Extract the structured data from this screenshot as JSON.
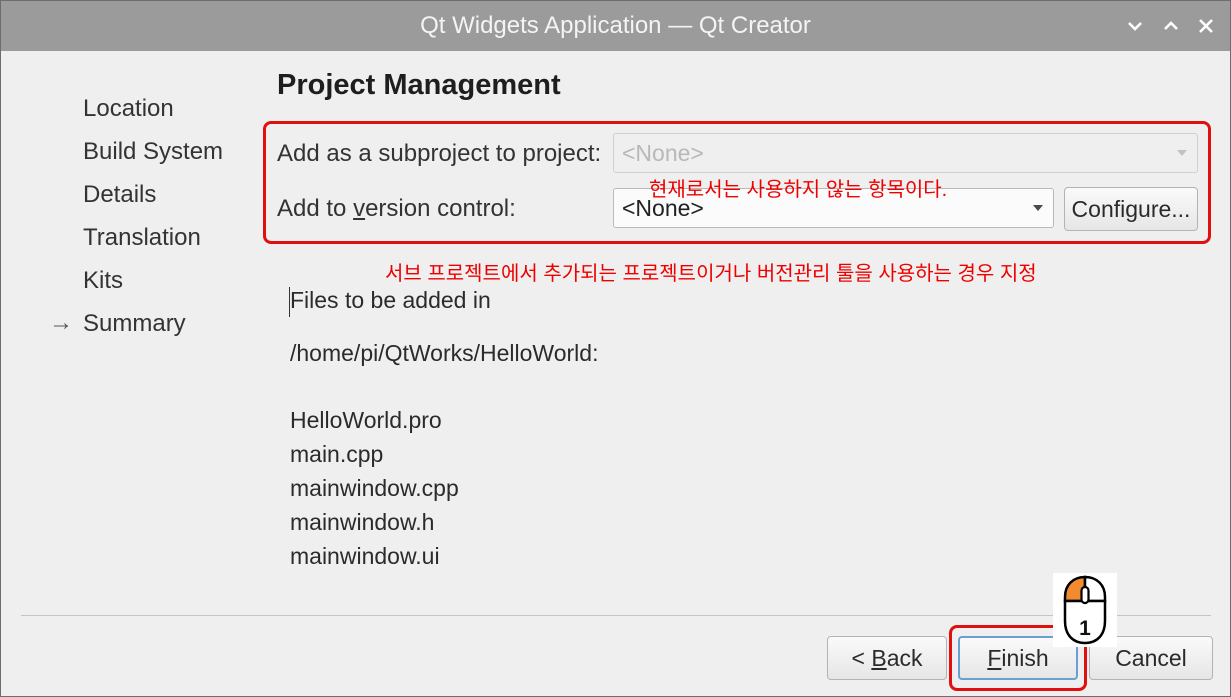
{
  "window": {
    "title": "Qt Widgets Application — Qt Creator"
  },
  "sidebar": {
    "current_marker": "→",
    "items": [
      {
        "label": "Location"
      },
      {
        "label": "Build System"
      },
      {
        "label": "Details"
      },
      {
        "label": "Translation"
      },
      {
        "label": "Kits"
      },
      {
        "label": "Summary"
      }
    ],
    "current_index": 5
  },
  "main": {
    "title": "Project Management",
    "subproject": {
      "label": "Add as a subproject to project:",
      "value": "<None>",
      "enabled": false
    },
    "version_control": {
      "label_pre": "Add to ",
      "label_mnemonic": "v",
      "label_post": "ersion control:",
      "value": "<None>",
      "configure_label": "Configure..."
    },
    "files_header_line1": "Files to be added in",
    "files_header_line2": "/home/pi/QtWorks/HelloWorld:",
    "files": [
      "HelloWorld.pro",
      "main.cpp",
      "mainwindow.cpp",
      "mainwindow.h",
      "mainwindow.ui"
    ]
  },
  "buttons": {
    "back_prefix": "< ",
    "back_mnemonic": "B",
    "back_rest": "ack",
    "finish_mnemonic": "F",
    "finish_rest": "inish",
    "cancel": "Cancel"
  },
  "annotations": {
    "note_unused": "현재로서는 사용하지 않는 항목이다.",
    "note_usage": "서브 프로젝트에서 추가되는 프로젝트이거나 버전관리 툴을 사용하는 경우 지정",
    "step_number": "1",
    "accent_color": "#e01010",
    "mouse_button_color": "#f28a30"
  }
}
